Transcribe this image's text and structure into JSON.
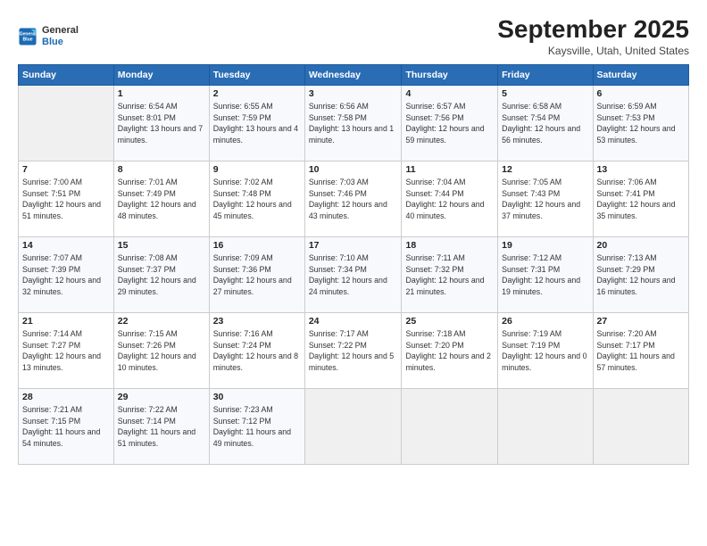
{
  "logo": {
    "line1": "General",
    "line2": "Blue"
  },
  "header": {
    "title": "September 2025",
    "location": "Kaysville, Utah, United States"
  },
  "weekdays": [
    "Sunday",
    "Monday",
    "Tuesday",
    "Wednesday",
    "Thursday",
    "Friday",
    "Saturday"
  ],
  "weeks": [
    [
      {
        "day": "",
        "empty": true
      },
      {
        "day": "1",
        "sunrise": "6:54 AM",
        "sunset": "8:01 PM",
        "daylight": "13 hours and 7 minutes."
      },
      {
        "day": "2",
        "sunrise": "6:55 AM",
        "sunset": "7:59 PM",
        "daylight": "13 hours and 4 minutes."
      },
      {
        "day": "3",
        "sunrise": "6:56 AM",
        "sunset": "7:58 PM",
        "daylight": "13 hours and 1 minute."
      },
      {
        "day": "4",
        "sunrise": "6:57 AM",
        "sunset": "7:56 PM",
        "daylight": "12 hours and 59 minutes."
      },
      {
        "day": "5",
        "sunrise": "6:58 AM",
        "sunset": "7:54 PM",
        "daylight": "12 hours and 56 minutes."
      },
      {
        "day": "6",
        "sunrise": "6:59 AM",
        "sunset": "7:53 PM",
        "daylight": "12 hours and 53 minutes."
      }
    ],
    [
      {
        "day": "7",
        "sunrise": "7:00 AM",
        "sunset": "7:51 PM",
        "daylight": "12 hours and 51 minutes."
      },
      {
        "day": "8",
        "sunrise": "7:01 AM",
        "sunset": "7:49 PM",
        "daylight": "12 hours and 48 minutes."
      },
      {
        "day": "9",
        "sunrise": "7:02 AM",
        "sunset": "7:48 PM",
        "daylight": "12 hours and 45 minutes."
      },
      {
        "day": "10",
        "sunrise": "7:03 AM",
        "sunset": "7:46 PM",
        "daylight": "12 hours and 43 minutes."
      },
      {
        "day": "11",
        "sunrise": "7:04 AM",
        "sunset": "7:44 PM",
        "daylight": "12 hours and 40 minutes."
      },
      {
        "day": "12",
        "sunrise": "7:05 AM",
        "sunset": "7:43 PM",
        "daylight": "12 hours and 37 minutes."
      },
      {
        "day": "13",
        "sunrise": "7:06 AM",
        "sunset": "7:41 PM",
        "daylight": "12 hours and 35 minutes."
      }
    ],
    [
      {
        "day": "14",
        "sunrise": "7:07 AM",
        "sunset": "7:39 PM",
        "daylight": "12 hours and 32 minutes."
      },
      {
        "day": "15",
        "sunrise": "7:08 AM",
        "sunset": "7:37 PM",
        "daylight": "12 hours and 29 minutes."
      },
      {
        "day": "16",
        "sunrise": "7:09 AM",
        "sunset": "7:36 PM",
        "daylight": "12 hours and 27 minutes."
      },
      {
        "day": "17",
        "sunrise": "7:10 AM",
        "sunset": "7:34 PM",
        "daylight": "12 hours and 24 minutes."
      },
      {
        "day": "18",
        "sunrise": "7:11 AM",
        "sunset": "7:32 PM",
        "daylight": "12 hours and 21 minutes."
      },
      {
        "day": "19",
        "sunrise": "7:12 AM",
        "sunset": "7:31 PM",
        "daylight": "12 hours and 19 minutes."
      },
      {
        "day": "20",
        "sunrise": "7:13 AM",
        "sunset": "7:29 PM",
        "daylight": "12 hours and 16 minutes."
      }
    ],
    [
      {
        "day": "21",
        "sunrise": "7:14 AM",
        "sunset": "7:27 PM",
        "daylight": "12 hours and 13 minutes."
      },
      {
        "day": "22",
        "sunrise": "7:15 AM",
        "sunset": "7:26 PM",
        "daylight": "12 hours and 10 minutes."
      },
      {
        "day": "23",
        "sunrise": "7:16 AM",
        "sunset": "7:24 PM",
        "daylight": "12 hours and 8 minutes."
      },
      {
        "day": "24",
        "sunrise": "7:17 AM",
        "sunset": "7:22 PM",
        "daylight": "12 hours and 5 minutes."
      },
      {
        "day": "25",
        "sunrise": "7:18 AM",
        "sunset": "7:20 PM",
        "daylight": "12 hours and 2 minutes."
      },
      {
        "day": "26",
        "sunrise": "7:19 AM",
        "sunset": "7:19 PM",
        "daylight": "12 hours and 0 minutes."
      },
      {
        "day": "27",
        "sunrise": "7:20 AM",
        "sunset": "7:17 PM",
        "daylight": "11 hours and 57 minutes."
      }
    ],
    [
      {
        "day": "28",
        "sunrise": "7:21 AM",
        "sunset": "7:15 PM",
        "daylight": "11 hours and 54 minutes."
      },
      {
        "day": "29",
        "sunrise": "7:22 AM",
        "sunset": "7:14 PM",
        "daylight": "11 hours and 51 minutes."
      },
      {
        "day": "30",
        "sunrise": "7:23 AM",
        "sunset": "7:12 PM",
        "daylight": "11 hours and 49 minutes."
      },
      {
        "day": "",
        "empty": true
      },
      {
        "day": "",
        "empty": true
      },
      {
        "day": "",
        "empty": true
      },
      {
        "day": "",
        "empty": true
      }
    ]
  ]
}
